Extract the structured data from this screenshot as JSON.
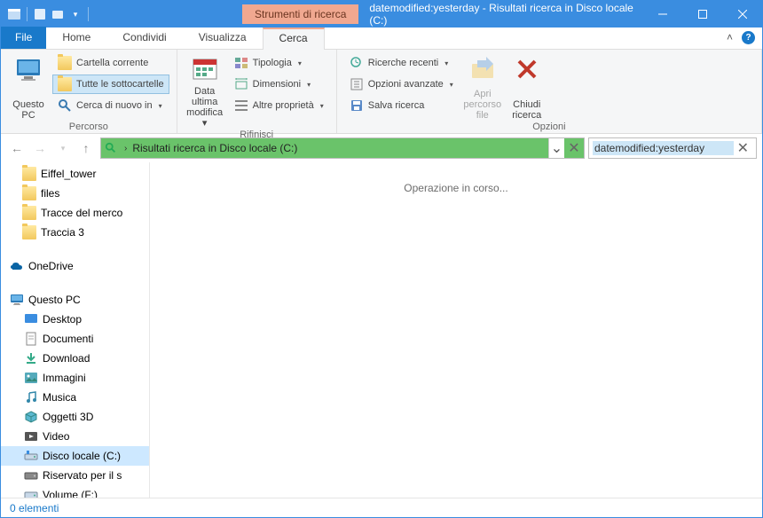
{
  "titlebar": {
    "contextual_tab": "Strumenti di ricerca",
    "title": "datemodified:yesterday - Risultati ricerca in Disco locale (C:)"
  },
  "tabs": {
    "file": "File",
    "home": "Home",
    "share": "Condividi",
    "view": "Visualizza",
    "search": "Cerca"
  },
  "ribbon": {
    "group_percorso": {
      "label": "Percorso",
      "this_pc": "Questo\nPC",
      "current_folder": "Cartella corrente",
      "all_subfolders": "Tutte le sottocartelle",
      "search_again": "Cerca di nuovo in"
    },
    "group_rifinisci": {
      "label": "Rifinisci",
      "date_modified": "Data ultima\nmodifica",
      "type": "Tipologia",
      "size": "Dimensioni",
      "other": "Altre proprietà"
    },
    "group_opzioni": {
      "label": "Opzioni",
      "recent": "Ricerche recenti",
      "advanced": "Opzioni avanzate",
      "save": "Salva ricerca",
      "open_loc": "Apri\npercorso file",
      "close": "Chiudi\nricerca"
    }
  },
  "address": {
    "text": "Risultati ricerca in Disco locale (C:)"
  },
  "search": {
    "query": "datemodified:yesterday"
  },
  "sidebar": {
    "folders": [
      "Eiffel_tower",
      "files",
      "Tracce del merco",
      "Traccia 3"
    ],
    "onedrive": "OneDrive",
    "this_pc": "Questo PC",
    "pc_items": [
      "Desktop",
      "Documenti",
      "Download",
      "Immagini",
      "Musica",
      "Oggetti 3D",
      "Video",
      "Disco locale (C:)",
      "Riservato per il s",
      "Volume (F:)"
    ]
  },
  "main": {
    "loading": "Operazione in corso..."
  },
  "status": {
    "items": "0 elementi"
  }
}
